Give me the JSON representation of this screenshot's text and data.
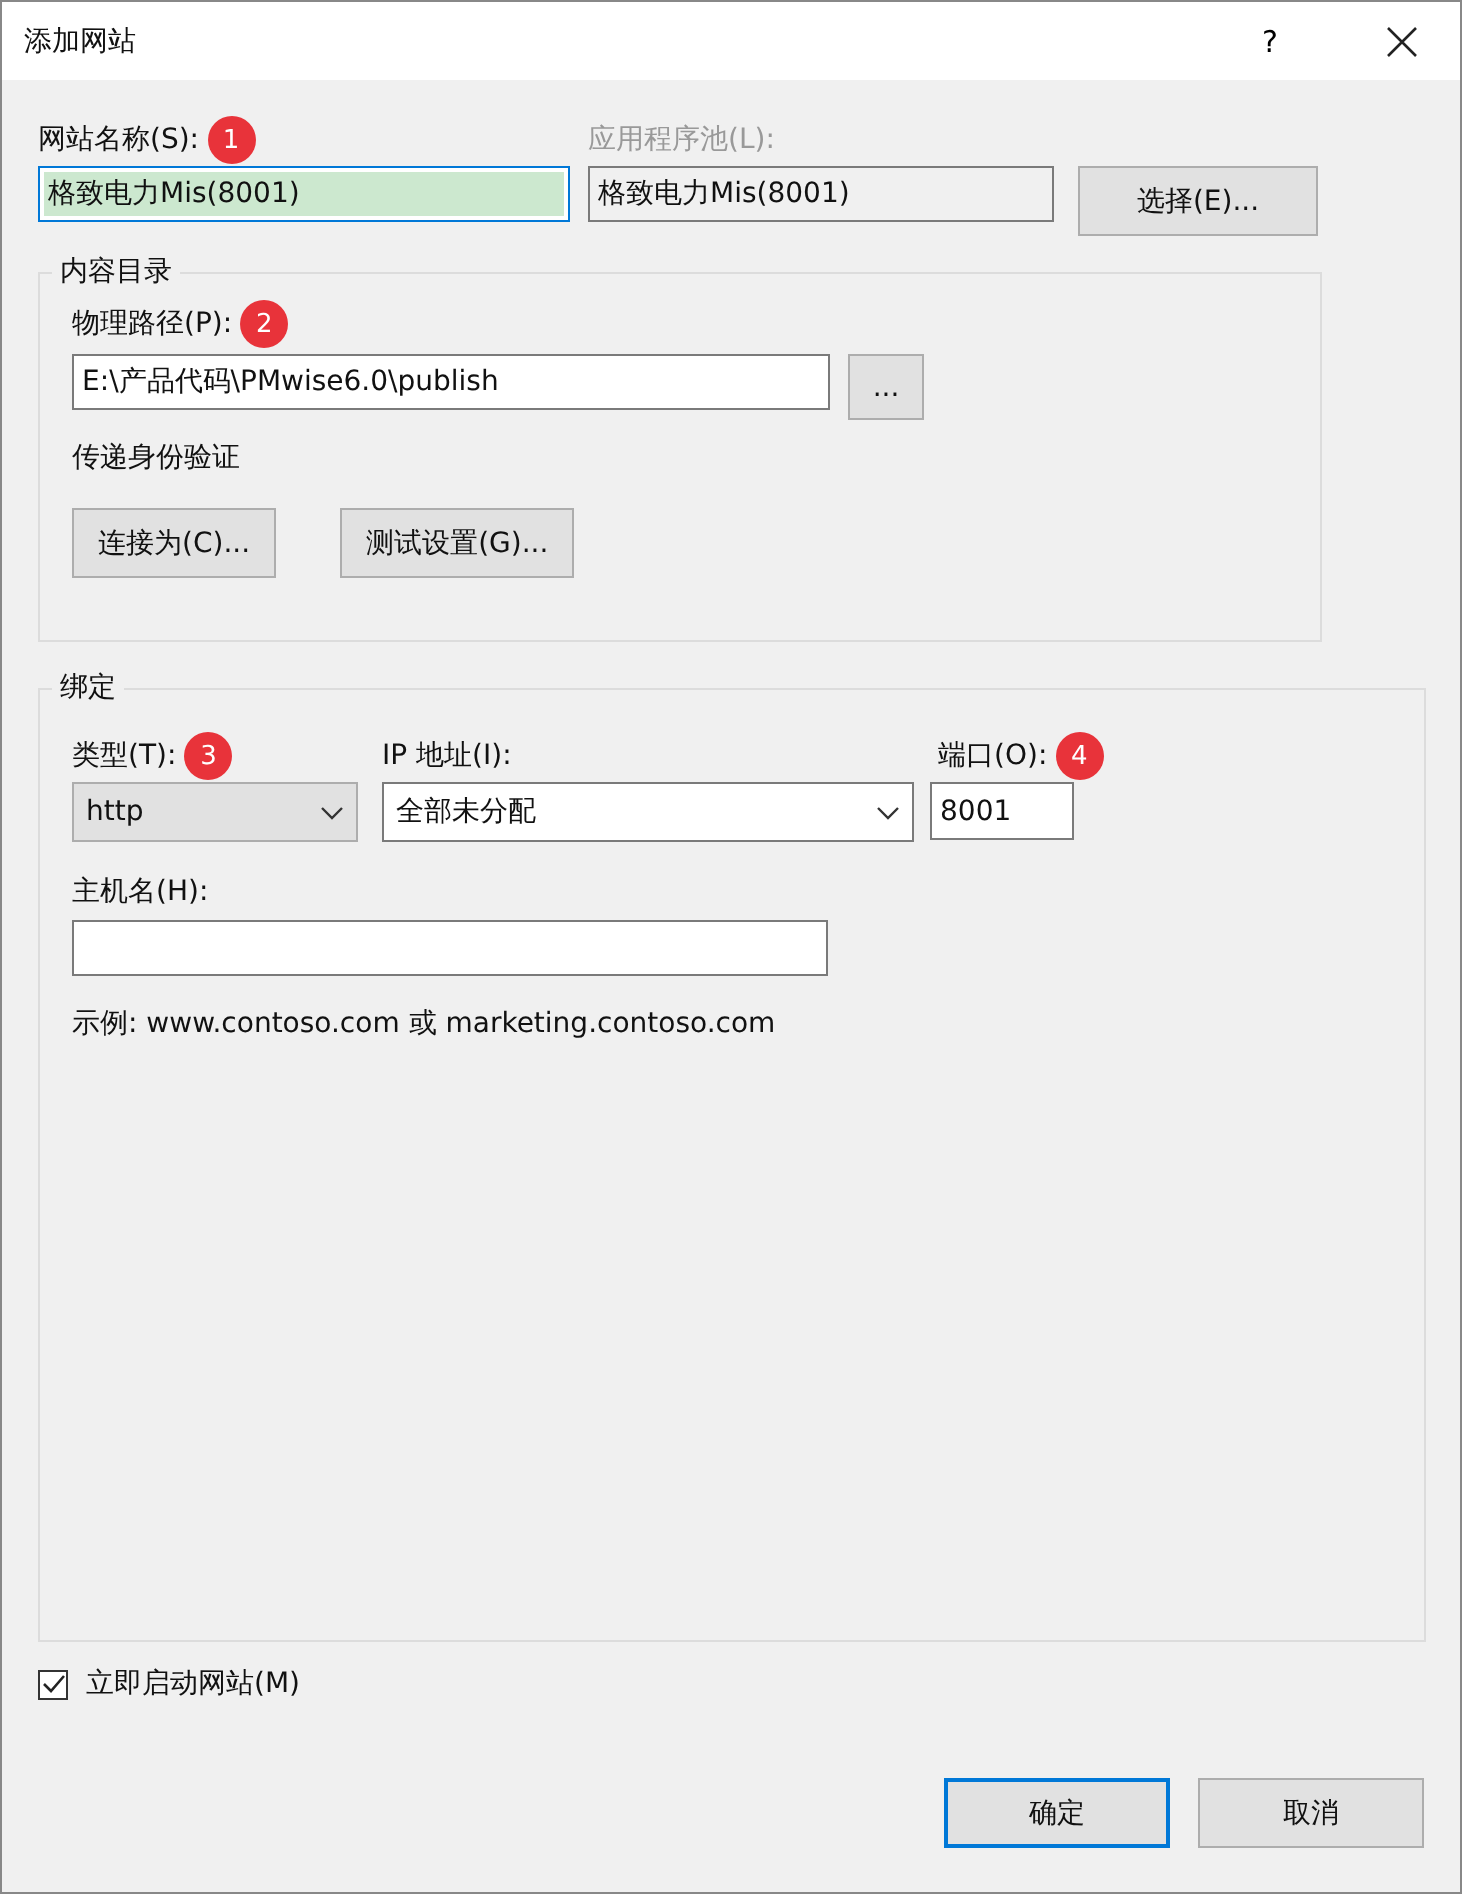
{
  "window": {
    "title": "添加网站",
    "help": "?"
  },
  "site_name": {
    "label": "网站名称(S):",
    "badge": "1",
    "value": "格致电力Mis(8001)"
  },
  "app_pool": {
    "label": "应用程序池(L):",
    "value": "格致电力Mis(8001)",
    "disabled": true
  },
  "select_button": "选择(E)...",
  "content_dir": {
    "title": "内容目录",
    "path_label": "物理路径(P):",
    "badge": "2",
    "path_value": "E:\\产品代码\\PMwise6.0\\publish",
    "browse_button": "...",
    "auth_label": "传递身份验证",
    "buttons": [
      "连接为(C)...",
      "测试设置(G)..."
    ]
  },
  "binding": {
    "title": "绑定",
    "type_label": "类型(T):",
    "type_badge": "3",
    "type_value": "http",
    "ip_label": "IP 地址(I):",
    "ip_value": "全部未分配",
    "port_label": "端口(O):",
    "port_badge": "4",
    "port_value": "8001",
    "host_label": "主机名(H):",
    "example": "示例: www.contoso.com 或 marketing.contoso.com"
  },
  "start_now": {
    "label": "立即启动网站(M)",
    "checked": true
  },
  "buttons": [
    {
      "label": "确定",
      "selected": true
    },
    {
      "label": "取消",
      "selected": false
    }
  ]
}
